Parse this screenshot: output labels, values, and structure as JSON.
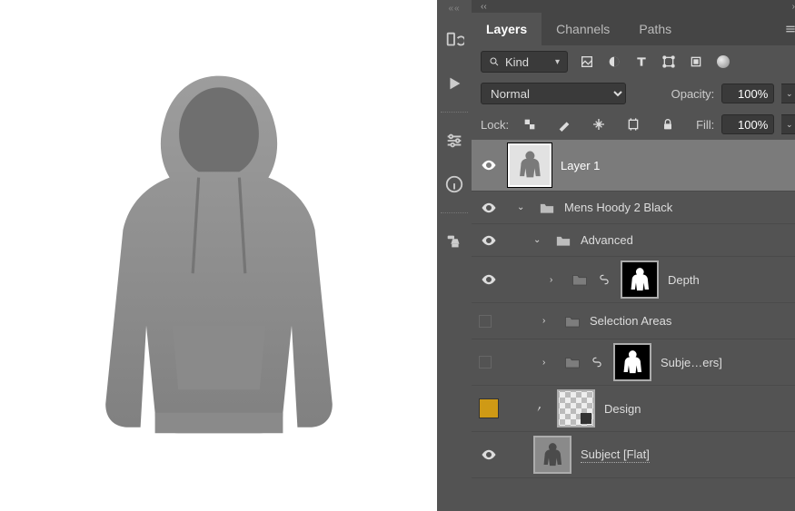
{
  "tabs": {
    "layers": "Layers",
    "channels": "Channels",
    "paths": "Paths"
  },
  "filter": {
    "kind_label": "Kind"
  },
  "blend": {
    "mode": "Normal",
    "opacity_label": "Opacity:",
    "opacity_value": "100%"
  },
  "lock": {
    "label": "Lock:",
    "fill_label": "Fill:",
    "fill_value": "100%"
  },
  "layers": {
    "layer1": "Layer 1",
    "group_main": "Mens Hoody 2 Black",
    "group_advanced": "Advanced",
    "depth": "Depth",
    "selection_areas": "Selection Areas",
    "subjects": "Subje…ers]",
    "design": "Design",
    "subject_flat": "Subject [Flat]"
  }
}
